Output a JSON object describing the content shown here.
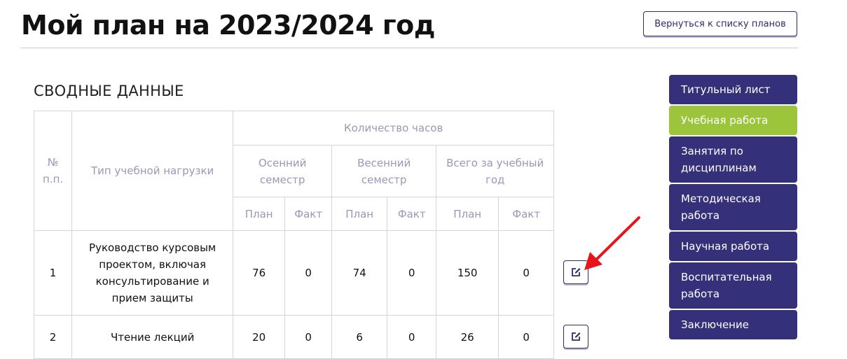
{
  "header": {
    "title": "Мой план на 2023/2024 год",
    "back_button": "Вернуться к списку планов"
  },
  "section_title": "СВОДНЫЕ ДАННЫЕ",
  "table": {
    "col_number": "№ п.п.",
    "col_type": "Тип учебной нагрузки",
    "group_hours": "Количество часов",
    "semesters": [
      "Осенний семестр",
      "Весенний семестр",
      "Всего за учебный год"
    ],
    "sub_plan": "План",
    "sub_fact": "Факт",
    "rows": [
      {
        "num": "1",
        "type": "Руководство курсовым проектом, включая консультирование и прием защиты",
        "values": [
          "76",
          "0",
          "74",
          "0",
          "150",
          "0"
        ]
      },
      {
        "num": "2",
        "type": "Чтение лекций",
        "values": [
          "20",
          "0",
          "6",
          "0",
          "26",
          "0"
        ]
      }
    ]
  },
  "sidebar": {
    "items": [
      {
        "label": "Титульный лист"
      },
      {
        "label": "Учебная работа"
      },
      {
        "label": "Занятия по дисциплинам"
      },
      {
        "label": "Методическая работа"
      },
      {
        "label": "Научная работа"
      },
      {
        "label": "Воспитательная работа"
      },
      {
        "label": "Заключение"
      }
    ],
    "active_index": 1
  },
  "icons": {
    "edit": "edit-icon",
    "annotation": "red-arrow-icon"
  },
  "colors": {
    "primary": "#35307a",
    "active": "#9cc53c",
    "header_text": "#9a98b8",
    "arrow": "#e8141b"
  }
}
